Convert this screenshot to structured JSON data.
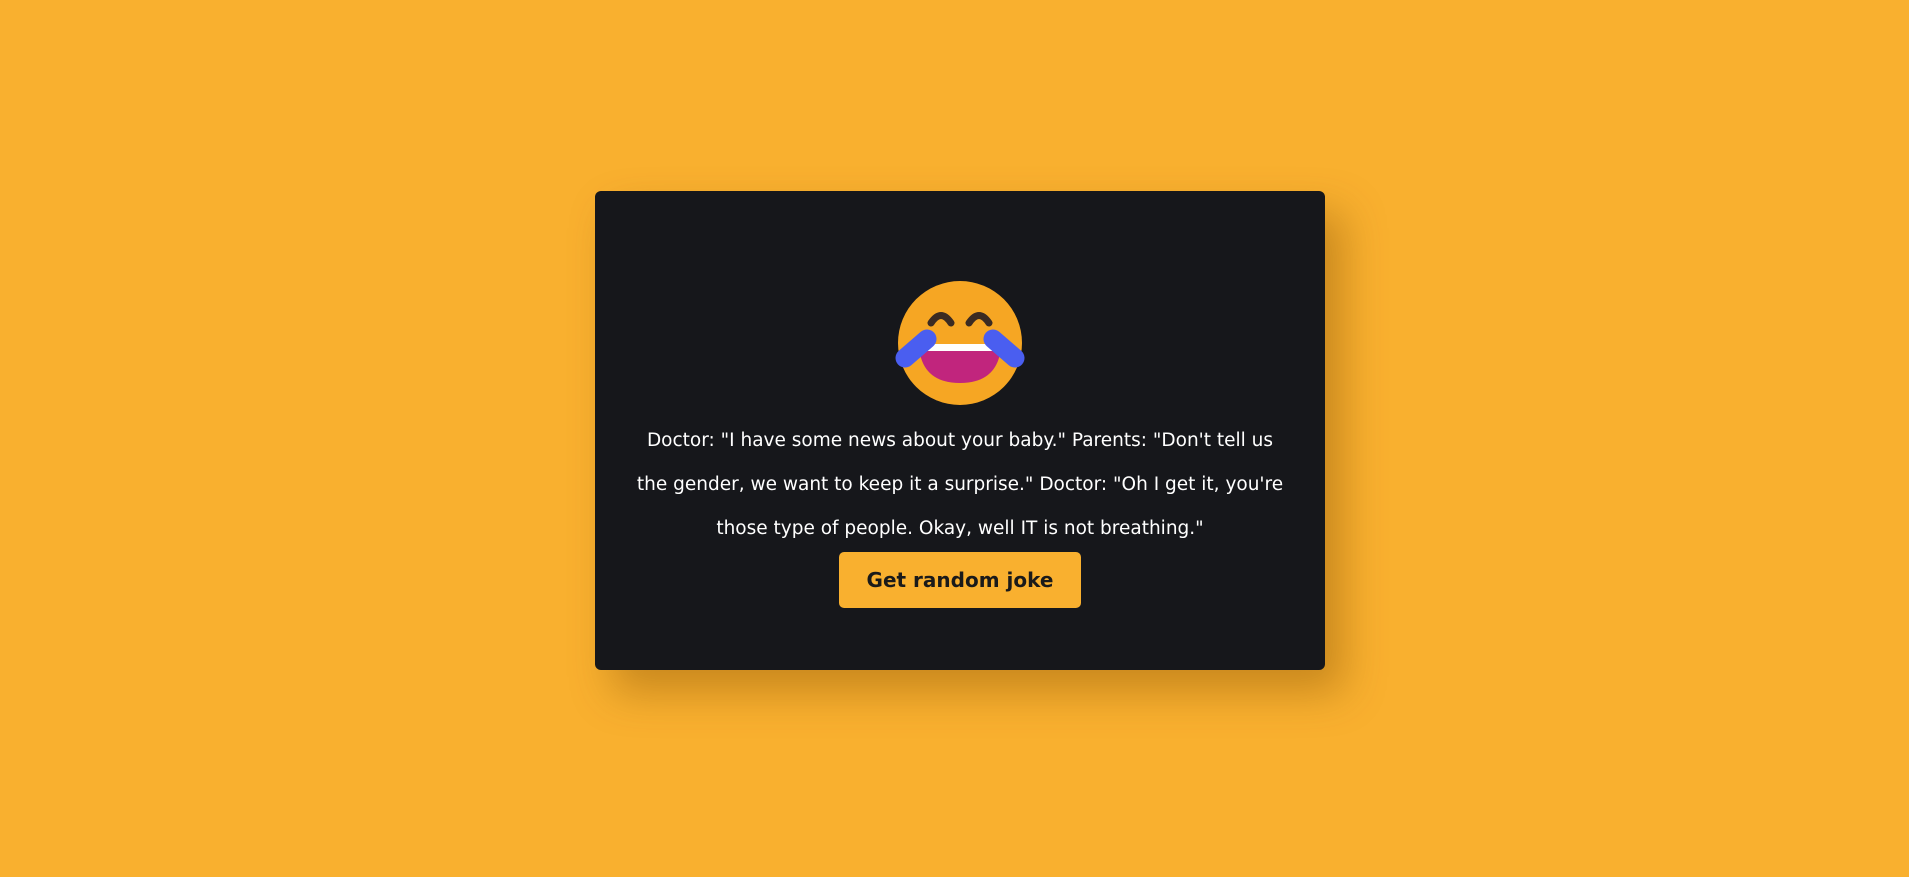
{
  "page": {
    "background_color": "#f9b02f",
    "card_color": "#16171b"
  },
  "joke_card": {
    "emoji_icon": "face-with-tears-of-joy-icon",
    "joke_text": "Doctor: \"I have some news about your baby.\" Parents: \"Don't tell us the gender, we want to keep it a surprise.\" Doctor: \"Oh I get it, you're those type of people. Okay, well IT is not breathing.\"",
    "button_label": "Get random joke",
    "button_color": "#f9b02f"
  }
}
